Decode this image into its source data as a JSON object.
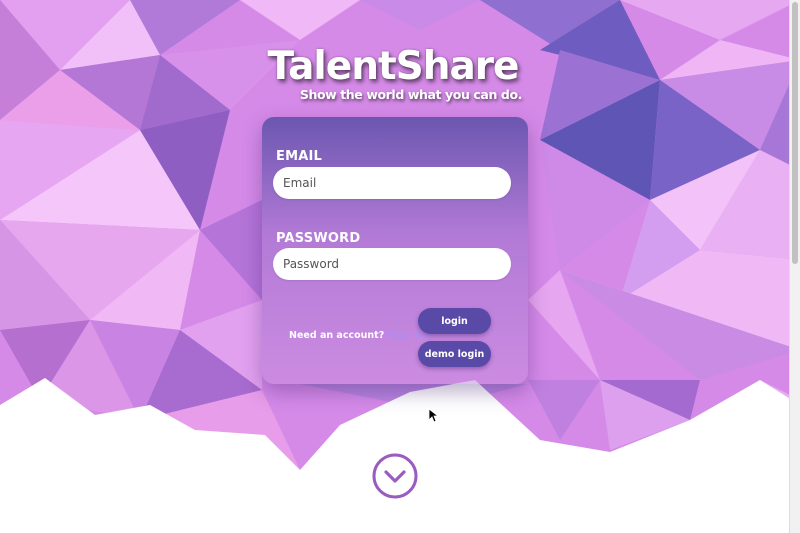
{
  "brand": {
    "title": "TalentShare",
    "tagline": "Show the world what you can do."
  },
  "login_form": {
    "email_label": "EMAIL",
    "email_placeholder": "Email",
    "email_value": "",
    "password_label": "PASSWORD",
    "password_placeholder": "Password",
    "password_value": "",
    "signup_prompt": "Need an account?",
    "signup_link": "Sign Up!",
    "login_button": "login",
    "demo_login_button": "demo login"
  },
  "icons": {
    "scroll_down": "chevron-down-circle-icon",
    "cursor": "mouse-cursor-icon"
  },
  "colors": {
    "button": "#5a4aa8",
    "signup_link": "#b08cf0",
    "scroll_icon": "#9a5cc0",
    "card_top": "#4e48a0",
    "card_bottom": "#c48cdc"
  }
}
